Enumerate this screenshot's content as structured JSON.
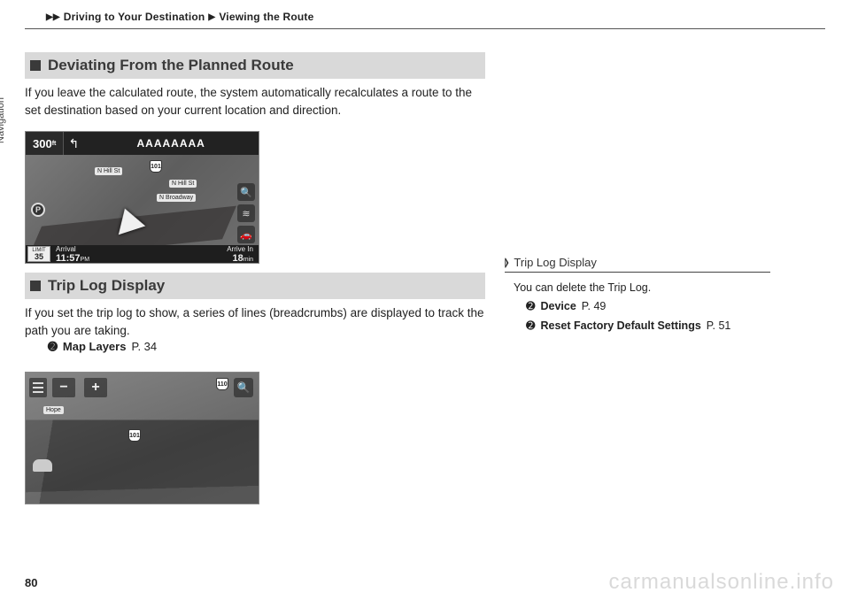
{
  "breadcrumb": {
    "a": "Driving to Your Destination",
    "b": "Viewing the Route"
  },
  "side_tab": "Navigation",
  "section1": {
    "title": "Deviating From the Planned Route",
    "body": "If you leave the calculated route, the system automatically recalculates a route to the set destination based on your current location and direction."
  },
  "section2": {
    "title": "Trip Log Display",
    "body": "If you set the trip log to show, a series of lines (breadcrumbs) are displayed to track the path you are taking.",
    "xref_label": "Map Layers",
    "xref_page": "P. 34"
  },
  "ss1": {
    "dist": "300",
    "dist_unit": "ft",
    "street": "AAAAAAAA",
    "label1": "N Hill St",
    "label2": "N Hill St",
    "label3": "N Broadway",
    "shield": "101",
    "limit_word": "LIMIT",
    "limit_val": "35",
    "arrival_word": "Arrival",
    "arrival_val": "11:57",
    "arrival_unit": "PM",
    "arrive_in_word": "Arrive In",
    "arrive_in_val": "18",
    "arrive_in_unit": "min"
  },
  "ss2": {
    "label1": "Hope",
    "shield1": "101",
    "shield2": "110"
  },
  "sidebar": {
    "head": "Trip Log Display",
    "line1": "You can delete the Trip Log.",
    "x1_label": "Device",
    "x1_page": "P. 49",
    "x2_label": "Reset Factory Default Settings",
    "x2_page": "P. 51"
  },
  "page_number": "80",
  "watermark": "carmanualsonline.info"
}
